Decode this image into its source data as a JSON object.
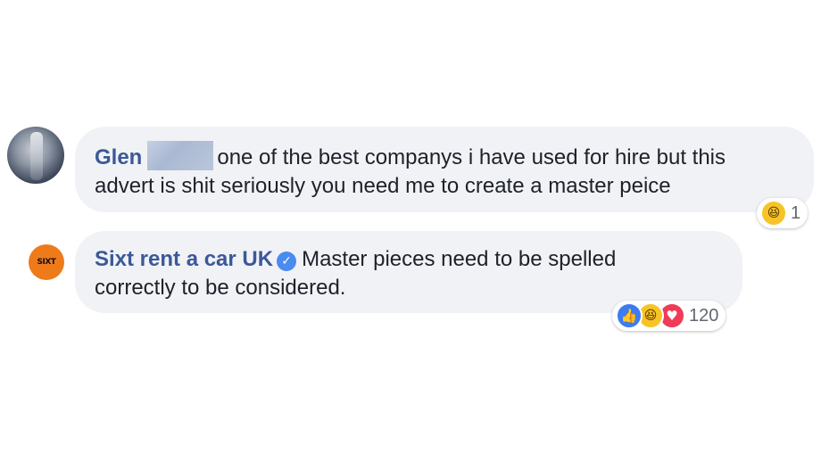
{
  "comments": [
    {
      "author": "Glen",
      "text_line1": "one of the best companys i have used for hire but this",
      "text_line2": "advert is shit seriously you need me to create a master peice",
      "reactions": {
        "icons": [
          "haha-icon"
        ],
        "count": "1"
      }
    },
    {
      "author": "Sixt rent a car UK",
      "verified": true,
      "avatar_text": "SIXT",
      "text_line1": "Master pieces need to be spelled",
      "text_line2": "correctly to be considered.",
      "reactions": {
        "icons": [
          "like-icon",
          "haha-icon",
          "love-icon"
        ],
        "count": "120"
      }
    }
  ],
  "colors": {
    "author": "#3b5998",
    "bubble": "#f1f2f6",
    "sixt_orange": "#ef7a1a",
    "like": "#3b7cf0",
    "haha": "#f7c428",
    "love": "#ef3b58"
  }
}
